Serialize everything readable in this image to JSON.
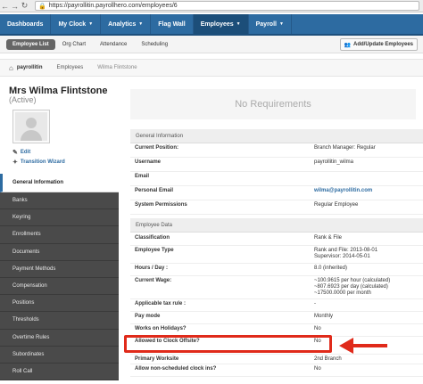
{
  "browser": {
    "url": "https://payrollitin.payrollhero.com/employees/6"
  },
  "topnav": [
    {
      "label": "Dashboards",
      "caret": false,
      "active": false
    },
    {
      "label": "My Clock",
      "caret": true,
      "active": false
    },
    {
      "label": "Analytics",
      "caret": true,
      "active": false
    },
    {
      "label": "Flag Wall",
      "caret": false,
      "active": false
    },
    {
      "label": "Employees",
      "caret": true,
      "active": true
    },
    {
      "label": "Payroll",
      "caret": true,
      "active": false
    }
  ],
  "subnav": {
    "items": [
      "Employee List",
      "Org Chart",
      "Attendance",
      "Scheduling"
    ],
    "add_button": "Add/Update Employees"
  },
  "breadcrumb": {
    "root": "payrollitin",
    "section": "Employees",
    "current": "Wilma Flintstone"
  },
  "profile": {
    "name": "Mrs Wilma Flintstone",
    "status": "(Active)",
    "edit": "Edit",
    "wizard": "Transition Wizard"
  },
  "menu": [
    "General Information",
    "Banks",
    "Keyring",
    "Enrollments",
    "Documents",
    "Payment Methods",
    "Compensation",
    "Positions",
    "Thresholds",
    "Overtime Rules",
    "Subordinates",
    "Roll Call"
  ],
  "main": {
    "no_requirements": "No Requirements",
    "general_header": "General Information",
    "general_rows": [
      {
        "label": "Current Position:",
        "value": "Branch Manager: Regular"
      },
      {
        "label": "Username",
        "value": "payrollitin_wilma"
      },
      {
        "label": "Email",
        "value": ""
      },
      {
        "label": "Personal Email",
        "value": "wilma@payrollitin.com"
      },
      {
        "label": "System Permissions",
        "value": "Regular Employee"
      }
    ],
    "employee_header": "Employee Data",
    "employee_rows": [
      {
        "label": "Classification",
        "value": "Rank & File"
      },
      {
        "label": "Employee Type",
        "value": "Rank and File: 2013-08-01\nSupervisor: 2014-05-01"
      },
      {
        "label": "Hours / Day :",
        "value": "8.0 (inherited)"
      },
      {
        "label": "Current Wage:",
        "value": "~100.9615 per hour (calculated)\n~807.6923 per day (calculated)\n~17500.0000 per month"
      },
      {
        "label": "Applicable tax rule :",
        "value": "-"
      },
      {
        "label": "Pay mode",
        "value": "Monthly"
      },
      {
        "label": "Works on Holidays?",
        "value": "No"
      },
      {
        "label": "Allowed to Clock Offsite?",
        "value": "No"
      },
      {
        "label": "Primary Worksite",
        "value": "2nd Branch"
      },
      {
        "label": "Allow non-scheduled clock ins?",
        "value": "No"
      }
    ]
  }
}
